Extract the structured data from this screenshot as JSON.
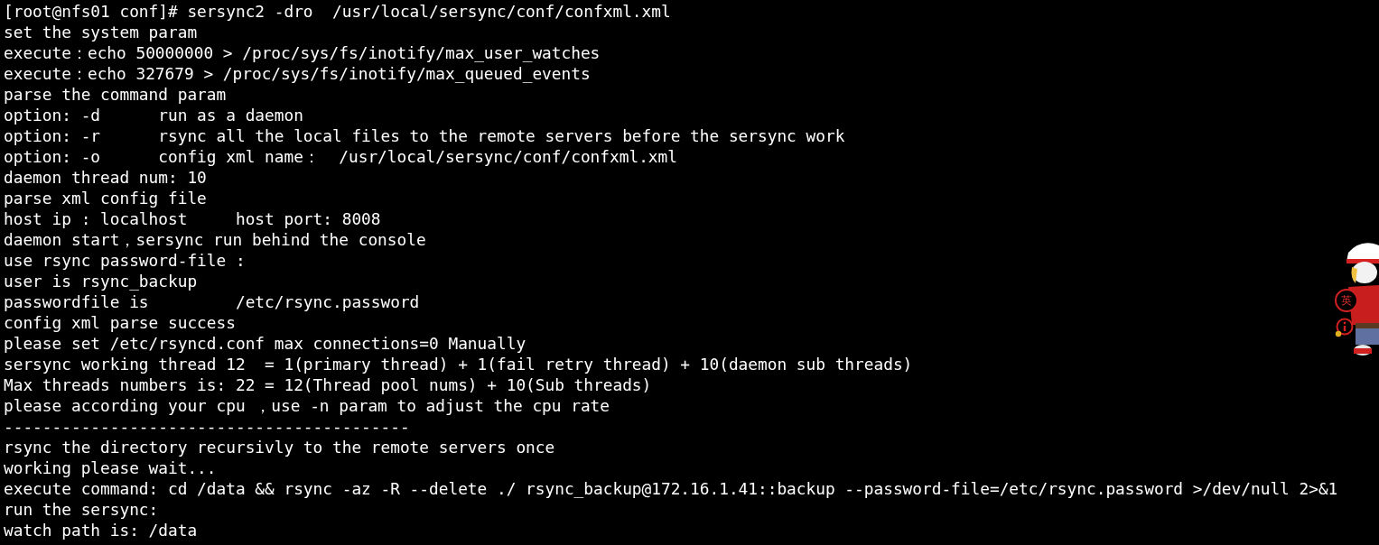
{
  "terminal": {
    "lines": [
      "[root@nfs01 conf]# sersync2 -dro  /usr/local/sersync/conf/confxml.xml",
      "set the system param",
      "execute：echo 50000000 > /proc/sys/fs/inotify/max_user_watches",
      "execute：echo 327679 > /proc/sys/fs/inotify/max_queued_events",
      "parse the command param",
      "option: -d      run as a daemon",
      "option: -r      rsync all the local files to the remote servers before the sersync work",
      "option: -o      config xml name：  /usr/local/sersync/conf/confxml.xml",
      "daemon thread num: 10",
      "parse xml config file",
      "host ip : localhost     host port: 8008",
      "daemon start，sersync run behind the console",
      "use rsync password-file :",
      "user is rsync_backup",
      "passwordfile is         /etc/rsync.password",
      "config xml parse success",
      "please set /etc/rsyncd.conf max connections=0 Manually",
      "sersync working thread 12  = 1(primary thread) + 1(fail retry thread) + 10(daemon sub threads)",
      "Max threads numbers is: 22 = 12(Thread pool nums) + 10(Sub threads)",
      "please according your cpu ，use -n param to adjust the cpu rate",
      "------------------------------------------",
      "rsync the directory recursivly to the remote servers once",
      "working please wait...",
      "execute command: cd /data && rsync -az -R --delete ./ rsync_backup@172.16.1.41::backup --password-file=/etc/rsync.password >/dev/null 2>&1",
      "run the sersync:",
      "watch path is: /data"
    ]
  },
  "ime_toolbar": {
    "buttons": [
      {
        "kind": "text",
        "label": "英"
      },
      {
        "kind": "icon"
      }
    ]
  }
}
